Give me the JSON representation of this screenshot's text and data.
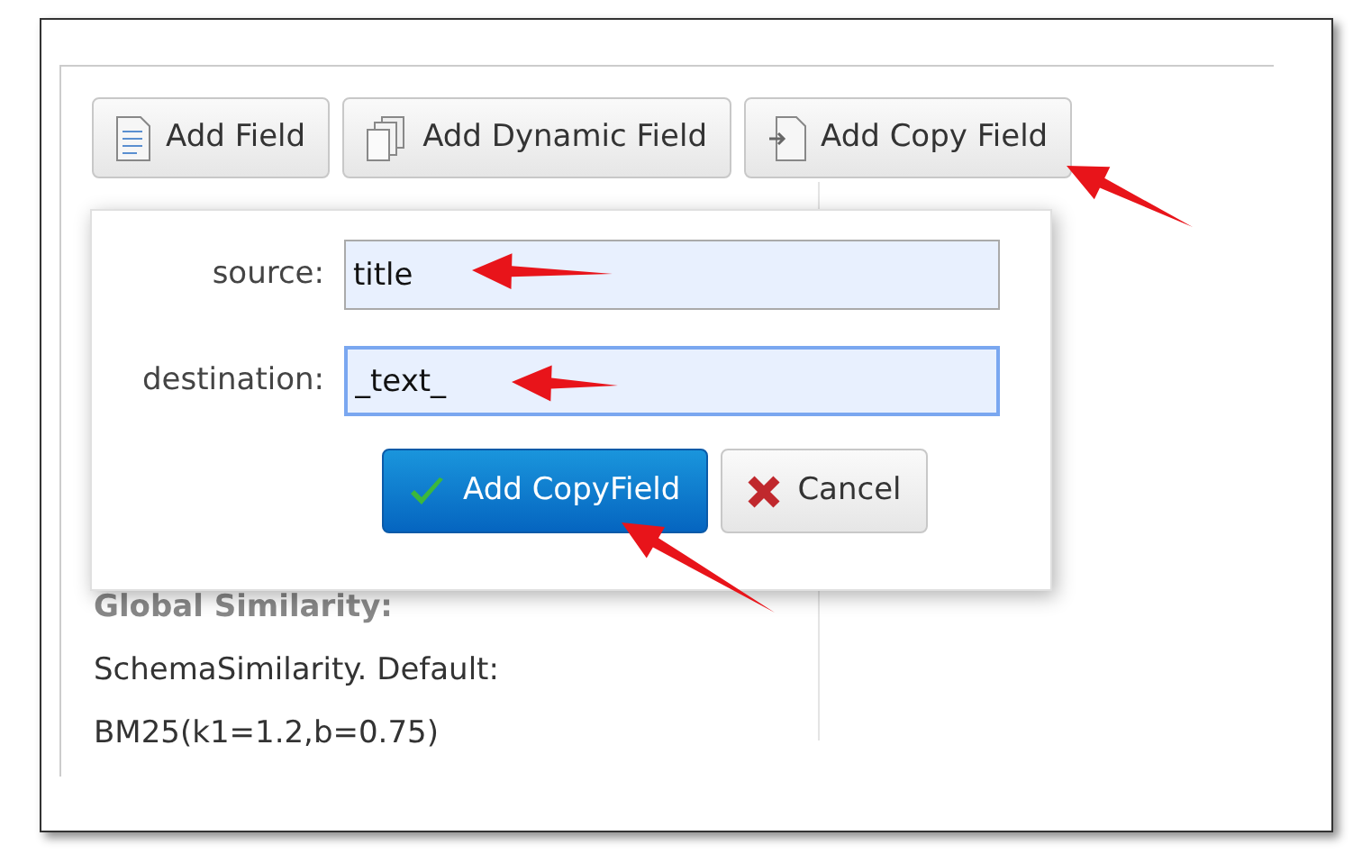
{
  "toolbar": {
    "buttons": [
      {
        "label": "Add Field",
        "kind": "field"
      },
      {
        "label": "Add Dynamic Field",
        "kind": "dynamic"
      },
      {
        "label": "Add Copy Field",
        "kind": "copy"
      }
    ]
  },
  "popup": {
    "fields": [
      {
        "label": "source:",
        "value": "title",
        "focused": false
      },
      {
        "label": "destination:",
        "value": "_text_",
        "focused": true
      }
    ],
    "buttons": [
      {
        "label": "Add CopyField",
        "kind": "primary"
      },
      {
        "label": "Cancel",
        "kind": "cancel"
      }
    ]
  },
  "details": {
    "heading": "Global Similarity:",
    "lines": [
      "SchemaSimilarity. Default:",
      "BM25(k1=1.2,b=0.75)"
    ]
  }
}
